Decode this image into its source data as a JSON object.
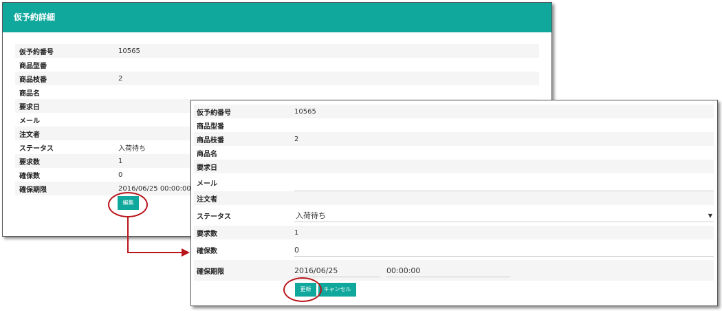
{
  "back_panel": {
    "title": "仮予約詳細",
    "rows": [
      {
        "label": "仮予約番号",
        "value": "10565"
      },
      {
        "label": "商品型番",
        "value": ""
      },
      {
        "label": "商品枝番",
        "value": "2"
      },
      {
        "label": "商品名",
        "value": ""
      },
      {
        "label": "要求日",
        "value": ""
      },
      {
        "label": "メール",
        "value": ""
      },
      {
        "label": "注文者",
        "value": ""
      },
      {
        "label": "ステータス",
        "value": "入荷待ち"
      },
      {
        "label": "要求数",
        "value": "1"
      },
      {
        "label": "確保数",
        "value": "0"
      },
      {
        "label": "確保期限",
        "value": "2016/06/25 00:00:00"
      }
    ],
    "edit_label": "編集"
  },
  "front_panel": {
    "labels": {
      "reservation_no": "仮予約番号",
      "model_no": "商品型番",
      "branch_no": "商品枝番",
      "product_name": "商品名",
      "request_date": "要求日",
      "email": "メール",
      "orderer": "注文者",
      "status": "ステータス",
      "requested_qty": "要求数",
      "secured_qty": "確保数",
      "deadline": "確保期限"
    },
    "values": {
      "reservation_no": "10565",
      "model_no": "",
      "branch_no": "2",
      "product_name": "",
      "request_date": "",
      "email": "",
      "orderer": "",
      "status": "入荷待ち",
      "requested_qty": "1",
      "secured_qty": "0",
      "deadline_date": "2016/06/25",
      "deadline_time": "00:00:00"
    },
    "update_label": "更新",
    "cancel_label": "キャンセル"
  },
  "colors": {
    "accent": "#10a89d",
    "highlight": "#b8141a"
  }
}
